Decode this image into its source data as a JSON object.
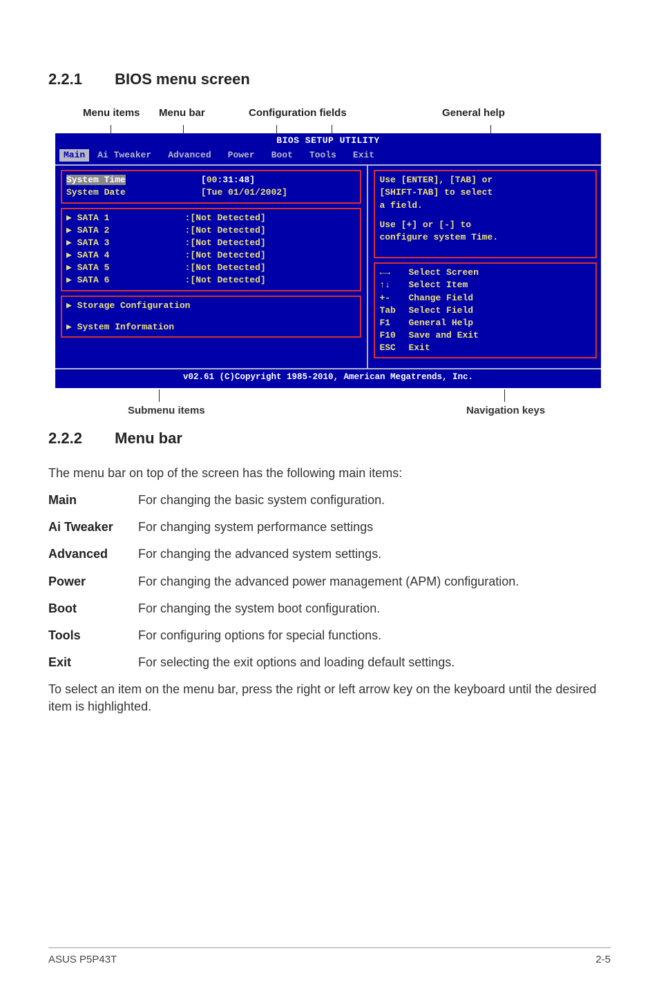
{
  "section221": {
    "num": "2.2.1",
    "title": "BIOS menu screen"
  },
  "annotations_top": {
    "menu_items": "Menu items",
    "menu_bar": "Menu bar",
    "config_fields": "Configuration fields",
    "general_help": "General help"
  },
  "bios": {
    "title": "BIOS SETUP UTILITY",
    "menubar": [
      "Main",
      "Ai Tweaker",
      "Advanced",
      "Power",
      "Boot",
      "Tools",
      "Exit"
    ],
    "active_tab": "Main",
    "left": {
      "system_time_label": "System Time",
      "system_time_value": "[00:31:48]",
      "system_time_hour": "00",
      "system_time_rest": ":31:48]",
      "system_date_label": "System Date",
      "system_date_value": "[Tue 01/01/2002]",
      "sata": [
        {
          "label": "SATA 1",
          "value": ":[Not Detected]"
        },
        {
          "label": "SATA 2",
          "value": ":[Not Detected]"
        },
        {
          "label": "SATA 3",
          "value": ":[Not Detected]"
        },
        {
          "label": "SATA 4",
          "value": ":[Not Detected]"
        },
        {
          "label": "SATA 5",
          "value": ":[Not Detected]"
        },
        {
          "label": "SATA 6",
          "value": ":[Not Detected]"
        }
      ],
      "storage_config": "Storage Configuration",
      "system_info": "System Information"
    },
    "right": {
      "help1": "Use [ENTER], [TAB] or",
      "help2": "[SHIFT-TAB] to select",
      "help3": "a field.",
      "help4": "Use [+] or [-] to",
      "help5": "configure system Time.",
      "nav": [
        {
          "key": "←→",
          "label": "Select Screen"
        },
        {
          "key": "↑↓",
          "label": "Select Item"
        },
        {
          "key": "+-",
          "label": "Change Field"
        },
        {
          "key": "Tab",
          "label": "Select Field"
        },
        {
          "key": "F1",
          "label": "General Help"
        },
        {
          "key": "F10",
          "label": "Save and Exit"
        },
        {
          "key": "ESC",
          "label": "Exit"
        }
      ]
    },
    "footer": "v02.61 (C)Copyright 1985-2010, American Megatrends, Inc."
  },
  "annotations_bottom": {
    "submenu": "Submenu items",
    "navkeys": "Navigation keys"
  },
  "section222": {
    "num": "2.2.2",
    "title": "Menu bar",
    "intro": "The menu bar on top of the screen has the following main items:",
    "rows": [
      {
        "term": "Main",
        "def": "For changing the basic system configuration."
      },
      {
        "term": "Ai Tweaker",
        "def": "For changing system performance settings"
      },
      {
        "term": "Advanced",
        "def": "For changing the advanced system settings."
      },
      {
        "term": "Power",
        "def": "For changing the advanced power management (APM) configuration."
      },
      {
        "term": "Boot",
        "def": "For changing the system boot configuration."
      },
      {
        "term": "Tools",
        "def": "For configuring options for special functions."
      },
      {
        "term": "Exit",
        "def": "For selecting the exit options and loading default settings."
      }
    ],
    "outro": "To select an item on the menu bar, press the right or left arrow key on the keyboard until the desired item is highlighted."
  },
  "footer": {
    "left": "ASUS P5P43T",
    "right": "2-5"
  }
}
